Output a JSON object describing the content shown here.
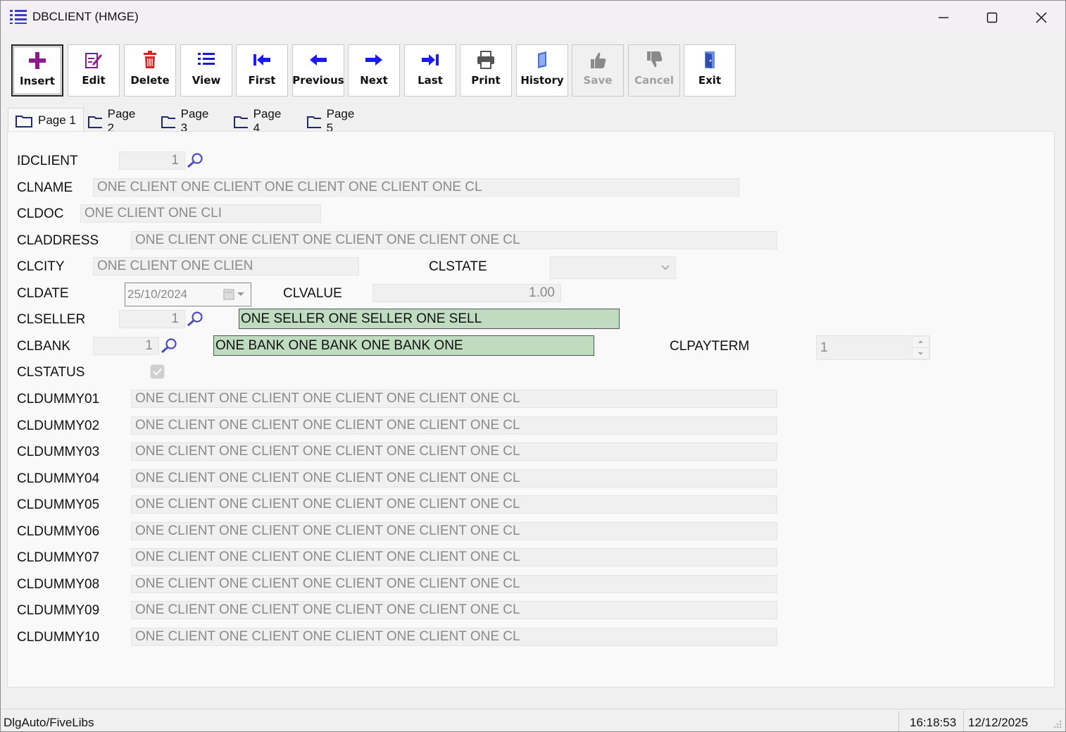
{
  "window": {
    "title": "DBCLIENT (HMGE)"
  },
  "toolbar": {
    "insert": "Insert",
    "edit": "Edit",
    "delete": "Delete",
    "view": "View",
    "first": "First",
    "previous": "Previous",
    "next": "Next",
    "last": "Last",
    "print": "Print",
    "history": "History",
    "save": "Save",
    "cancel": "Cancel",
    "exit": "Exit"
  },
  "tabs": [
    "Page 1",
    "Page 2",
    "Page 3",
    "Page 4",
    "Page 5"
  ],
  "form": {
    "idclient": {
      "label": "IDCLIENT",
      "value": "1"
    },
    "clname": {
      "label": "CLNAME",
      "value": "ONE CLIENT ONE CLIENT ONE CLIENT ONE CLIENT ONE CL"
    },
    "cldoc": {
      "label": "CLDOC",
      "value": "ONE CLIENT ONE CLI"
    },
    "claddress": {
      "label": "CLADDRESS",
      "value": "ONE CLIENT ONE CLIENT ONE CLIENT ONE CLIENT ONE CL"
    },
    "clcity": {
      "label": "CLCITY",
      "value": "ONE CLIENT ONE CLIEN"
    },
    "clstate": {
      "label": "CLSTATE",
      "value": ""
    },
    "cldate": {
      "label": "CLDATE",
      "value": "25/10/2024"
    },
    "clvalue": {
      "label": "CLVALUE",
      "value": "1.00"
    },
    "clseller": {
      "label": "CLSELLER",
      "value": "1",
      "description": "ONE SELLER ONE SELLER ONE SELL"
    },
    "clbank": {
      "label": "CLBANK",
      "value": "1",
      "description": "ONE BANK ONE BANK ONE BANK ONE"
    },
    "clpayterm": {
      "label": "CLPAYTERM",
      "value": "1"
    },
    "clstatus": {
      "label": "CLSTATUS",
      "checked": true
    },
    "dummies": [
      {
        "label": "CLDUMMY01",
        "value": "ONE CLIENT ONE CLIENT ONE CLIENT ONE CLIENT ONE CL"
      },
      {
        "label": "CLDUMMY02",
        "value": "ONE CLIENT ONE CLIENT ONE CLIENT ONE CLIENT ONE CL"
      },
      {
        "label": "CLDUMMY03",
        "value": "ONE CLIENT ONE CLIENT ONE CLIENT ONE CLIENT ONE CL"
      },
      {
        "label": "CLDUMMY04",
        "value": "ONE CLIENT ONE CLIENT ONE CLIENT ONE CLIENT ONE CL"
      },
      {
        "label": "CLDUMMY05",
        "value": "ONE CLIENT ONE CLIENT ONE CLIENT ONE CLIENT ONE CL"
      },
      {
        "label": "CLDUMMY06",
        "value": "ONE CLIENT ONE CLIENT ONE CLIENT ONE CLIENT ONE CL"
      },
      {
        "label": "CLDUMMY07",
        "value": "ONE CLIENT ONE CLIENT ONE CLIENT ONE CLIENT ONE CL"
      },
      {
        "label": "CLDUMMY08",
        "value": "ONE CLIENT ONE CLIENT ONE CLIENT ONE CLIENT ONE CL"
      },
      {
        "label": "CLDUMMY09",
        "value": "ONE CLIENT ONE CLIENT ONE CLIENT ONE CLIENT ONE CL"
      },
      {
        "label": "CLDUMMY10",
        "value": "ONE CLIENT ONE CLIENT ONE CLIENT ONE CLIENT ONE CL"
      }
    ]
  },
  "statusbar": {
    "left": "DlgAuto/FiveLibs",
    "time": "16:18:53",
    "date": "12/12/2025"
  },
  "colors": {
    "lookup_green": "#c0dcc0",
    "insert_icon": "#8b1a8b",
    "delete_icon": "#e02020",
    "nav_icon": "#1a1aff",
    "window_bg": "#f0f0f0"
  },
  "icons": [
    "list-icon",
    "minimize-icon",
    "maximize-icon",
    "close-icon",
    "plus-icon",
    "edit-icon",
    "trash-icon",
    "list-view-icon",
    "first-icon",
    "previous-icon",
    "next-icon",
    "last-icon",
    "printer-icon",
    "history-icon",
    "thumbs-up-icon",
    "thumbs-down-icon",
    "door-icon",
    "folder-icon",
    "search-icon",
    "calendar-icon",
    "chevron-down-icon",
    "spin-icon",
    "checkbox-icon"
  ]
}
